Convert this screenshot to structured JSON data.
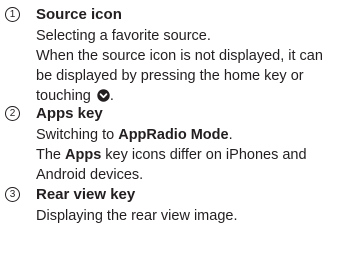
{
  "items": [
    {
      "number": "1",
      "title": "Source icon",
      "lines": {
        "l1": "Selecting a favorite source.",
        "l2": "When the source icon is not displayed, it can",
        "l3": "be displayed by pressing the home key or",
        "l4": "touching",
        "l4_end": "."
      },
      "icon": "circle-chevron-down-icon"
    },
    {
      "number": "2",
      "title": "Apps key",
      "lines": {
        "l1_pre": "Switching to ",
        "l1_bold": "AppRadio Mode",
        "l1_post": ".",
        "l2_pre": "The ",
        "l2_bold": "Apps",
        "l2_post": " key icons differ on iPhones and",
        "l3": "Android devices."
      }
    },
    {
      "number": "3",
      "title": "Rear view key",
      "lines": {
        "l1": "Displaying the rear view image."
      }
    }
  ]
}
